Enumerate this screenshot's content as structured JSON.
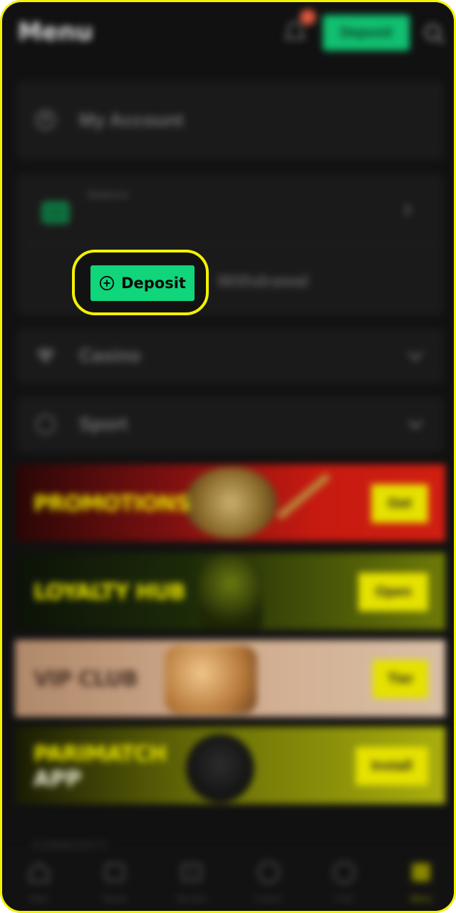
{
  "header": {
    "title": "Menu",
    "deposit_label": "Deposit"
  },
  "account": {
    "label": "My Account"
  },
  "balance": {
    "label": "Balance",
    "deposit_label": "Deposit",
    "withdrawal_label": "Withdrawal"
  },
  "menu": {
    "casino": "Casino",
    "sport": "Sport"
  },
  "banners": {
    "promotions": {
      "title": "PROMOTIONS",
      "button": "Get"
    },
    "loyalty": {
      "title": "LOYALTY HUB",
      "button": "Open"
    },
    "vip": {
      "title": "VIP CLUB",
      "button": "Tier"
    },
    "app": {
      "title": "PARIMATCH",
      "subtitle": "APP",
      "button": "Install"
    }
  },
  "community": {
    "label": "COMMUNITY"
  },
  "nav": [
    {
      "label": "Main",
      "icon": "home-icon"
    },
    {
      "label": "Sports",
      "icon": "ticket-icon"
    },
    {
      "label": "My bets",
      "icon": "bets-icon"
    },
    {
      "label": "Casino",
      "icon": "casino-chip-icon"
    },
    {
      "label": "Chat",
      "icon": "chat-icon"
    },
    {
      "label": "Menu",
      "icon": "menu-grid-icon"
    }
  ],
  "colors": {
    "accent_green": "#10d57b",
    "highlight_yellow": "#f4f200",
    "brand_yellow": "#e5e100"
  }
}
